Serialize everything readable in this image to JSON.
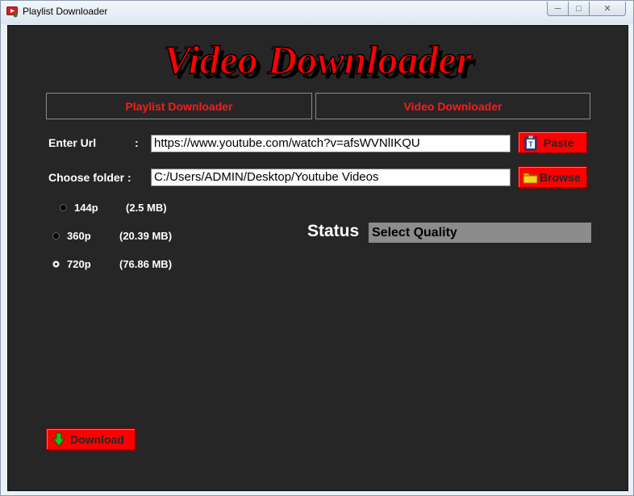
{
  "window": {
    "title": "Playlist Downloader"
  },
  "logo": {
    "text": "Video Downloader"
  },
  "tabs": [
    {
      "label": "Playlist Downloader"
    },
    {
      "label": "Video Downloader"
    }
  ],
  "form": {
    "url_label": "Enter Url",
    "url_colon": ":",
    "url_value": "https://www.youtube.com/watch?v=afsWVNlIKQU",
    "paste_label": "Paste",
    "folder_label": "Choose folder :",
    "folder_value": "C:/Users/ADMIN/Desktop/Youtube Videos",
    "browse_label": "Browse"
  },
  "quality": {
    "selected": "720p",
    "options": [
      {
        "label": "144p",
        "size": "(2.5 MB)"
      },
      {
        "label": "360p",
        "size": "(20.39 MB)"
      },
      {
        "label": "720p",
        "size": "(76.86 MB)"
      }
    ]
  },
  "status": {
    "label": "Status",
    "value": "Select Quality"
  },
  "download": {
    "label": "Download"
  },
  "colors": {
    "accent": "#ff0000",
    "background": "#262626",
    "status_box": "#8c8c8c"
  },
  "icons": {
    "app": "youtube-app-icon",
    "paste": "clipboard-icon",
    "browse": "folder-icon",
    "download": "down-arrow-icon"
  }
}
